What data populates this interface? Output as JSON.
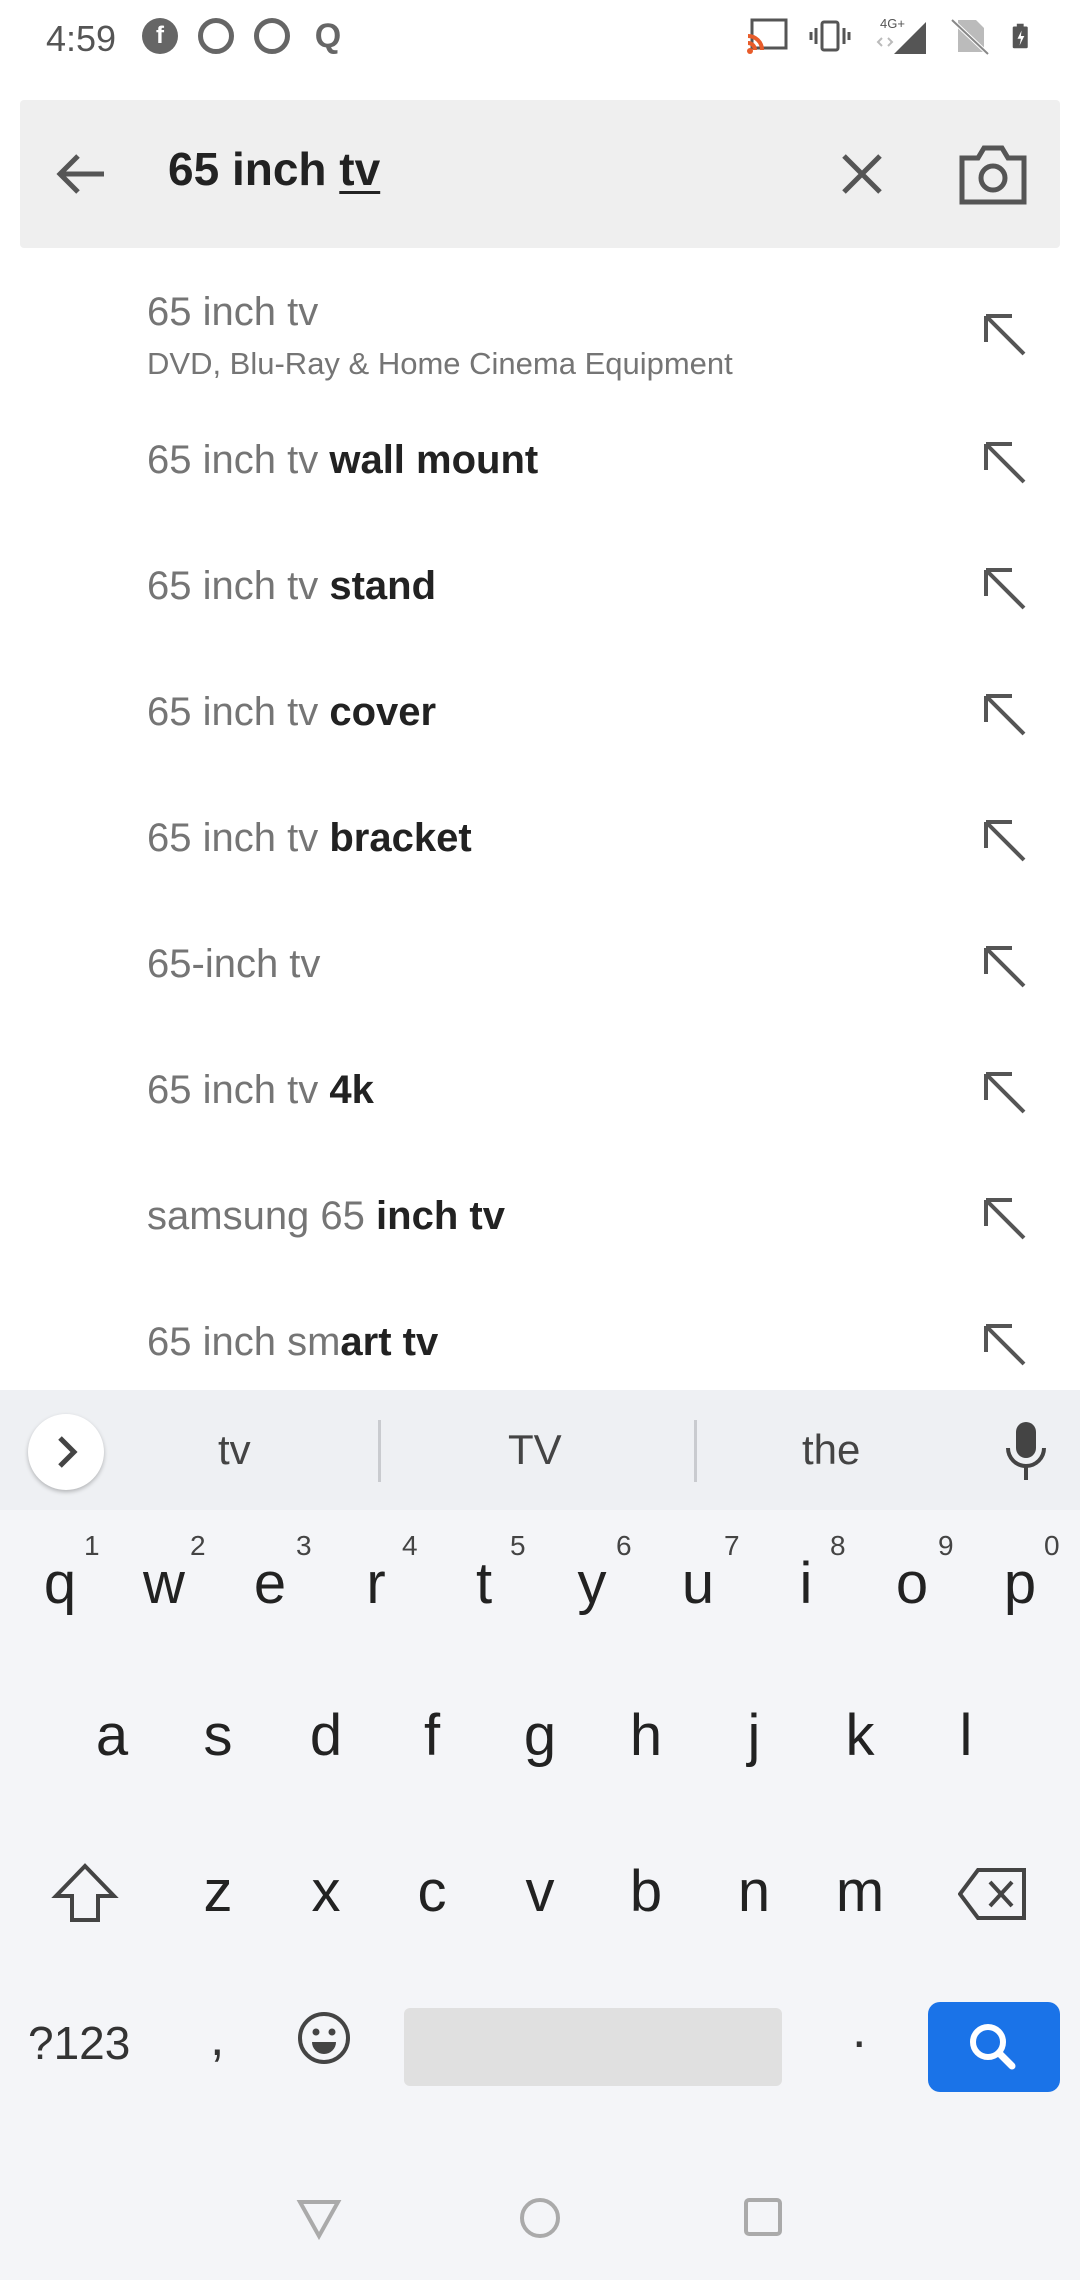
{
  "status_bar": {
    "time": "4:59",
    "left_icons": [
      "facebook-icon",
      "chrome-icon",
      "chrome-icon",
      "quora-icon"
    ],
    "network_label": "4G+"
  },
  "search": {
    "query_plain": "65 inch ",
    "query_underlined": "tv"
  },
  "suggestions": [
    {
      "prefix": "65 inch tv",
      "bold": "",
      "sub": "DVD, Blu-Ray & Home Cinema Equipment"
    },
    {
      "prefix": "65 inch tv ",
      "bold": "wall mount"
    },
    {
      "prefix": "65 inch tv ",
      "bold": "stand"
    },
    {
      "prefix": "65 inch tv ",
      "bold": "cover"
    },
    {
      "prefix": "65 inch tv ",
      "bold": "bracket"
    },
    {
      "prefix": "65-inch tv",
      "bold": ""
    },
    {
      "prefix": "65 inch tv ",
      "bold": "4k"
    },
    {
      "prefix": "samsung 65 ",
      "bold": "inch tv"
    },
    {
      "prefix": "65 inch sm",
      "bold": "art tv"
    }
  ],
  "keyboard": {
    "word_suggestions": [
      "tv",
      "TV",
      "the"
    ],
    "row1": [
      "q",
      "w",
      "e",
      "r",
      "t",
      "y",
      "u",
      "i",
      "o",
      "p"
    ],
    "row1_numbers": [
      "1",
      "2",
      "3",
      "4",
      "5",
      "6",
      "7",
      "8",
      "9",
      "0"
    ],
    "row2": [
      "a",
      "s",
      "d",
      "f",
      "g",
      "h",
      "j",
      "k",
      "l"
    ],
    "row3": [
      "z",
      "x",
      "c",
      "v",
      "b",
      "n",
      "m"
    ],
    "symbols_label": "?123",
    "comma": ",",
    "period": "."
  },
  "colors": {
    "accent": "#1a73e8",
    "search_bar_bg": "#efefef",
    "keyboard_bg": "#f4f5f8"
  }
}
